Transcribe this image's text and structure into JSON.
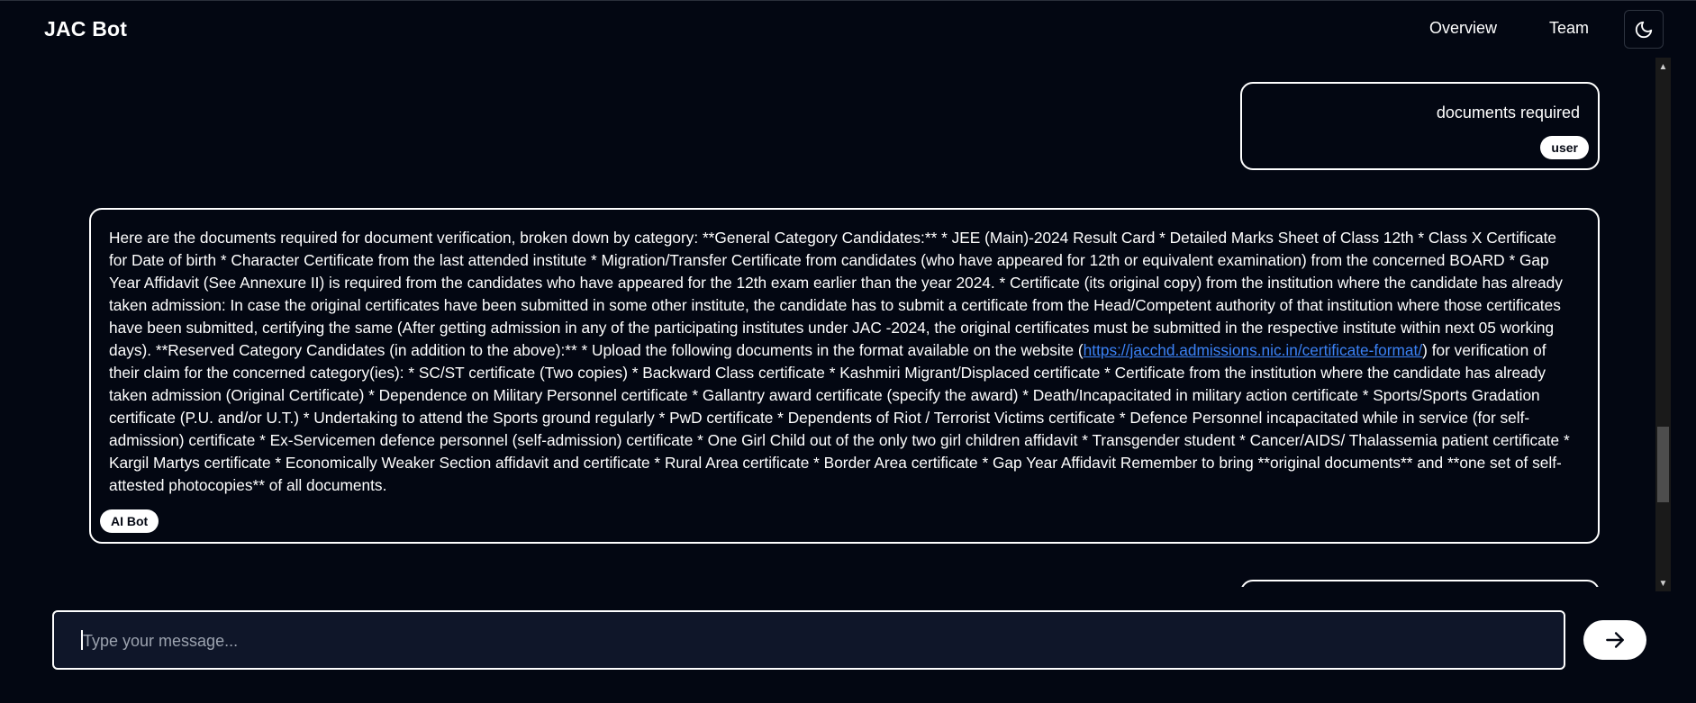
{
  "header": {
    "brand": "JAC Bot",
    "nav": [
      {
        "label": "Overview"
      },
      {
        "label": "Team"
      }
    ],
    "theme_toggle_icon": "moon-icon"
  },
  "messages": [
    {
      "role": "user",
      "text": "documents required",
      "badge": "user"
    },
    {
      "role": "bot",
      "text_before_link": "Here are the documents required for document verification, broken down by category: **General Category Candidates:** * JEE (Main)-2024 Result Card * Detailed Marks Sheet of Class 12th * Class X Certificate for Date of birth * Character Certificate from the last attended institute * Migration/Transfer Certificate from candidates (who have appeared for 12th or equivalent examination) from the concerned BOARD * Gap Year Affidavit (See Annexure II) is required from the candidates who have appeared for the 12th exam earlier than the year 2024. * Certificate (its original copy) from the institution where the candidate has already taken admission: In case the original certificates have been submitted in some other institute, the candidate has to submit a certificate from the Head/Competent authority of that institution where those certificates have been submitted, certifying the same (After getting admission in any of the participating institutes under JAC -2024, the original certificates must be submitted in the respective institute within next 05 working days). **Reserved Category Candidates (in addition to the above):** * Upload the following documents in the format available on the website (",
      "link": "https://jacchd.admissions.nic.in/certificate-format/",
      "text_after_link": ") for verification of their claim for the concerned category(ies): * SC/ST certificate (Two copies) * Backward Class certificate * Kashmiri Migrant/Displaced certificate * Certificate from the institution where the candidate has already taken admission (Original Certificate) * Dependence on Military Personnel certificate * Gallantry award certificate (specify the award) * Death/Incapacitated in military action certificate * Sports/Sports Gradation certificate (P.U. and/or U.T.) * Undertaking to attend the Sports ground regularly * PwD certificate * Dependents of Riot / Terrorist Victims certificate * Defence Personnel incapacitated while in service (for self-admission) certificate * Ex-Servicemen defence personnel (self-admission) certificate * One Girl Child out of the only two girl children affidavit * Transgender student * Cancer/AIDS/ Thalassemia patient certificate * Kargil Martys certificate * Economically Weaker Section affidavit and certificate * Rural Area certificate * Border Area certificate * Gap Year Affidavit Remember to bring **original documents** and **one set of self-attested photocopies** of all documents.",
      "badge": "AI Bot"
    }
  ],
  "composer": {
    "placeholder": "Type your message...",
    "value": "",
    "send_icon": "arrow-right-icon"
  },
  "scrollbar": {
    "up_icon": "scroll-up-arrow-icon",
    "down_icon": "scroll-down-arrow-icon",
    "up_glyph": "▲",
    "down_glyph": "▼"
  }
}
